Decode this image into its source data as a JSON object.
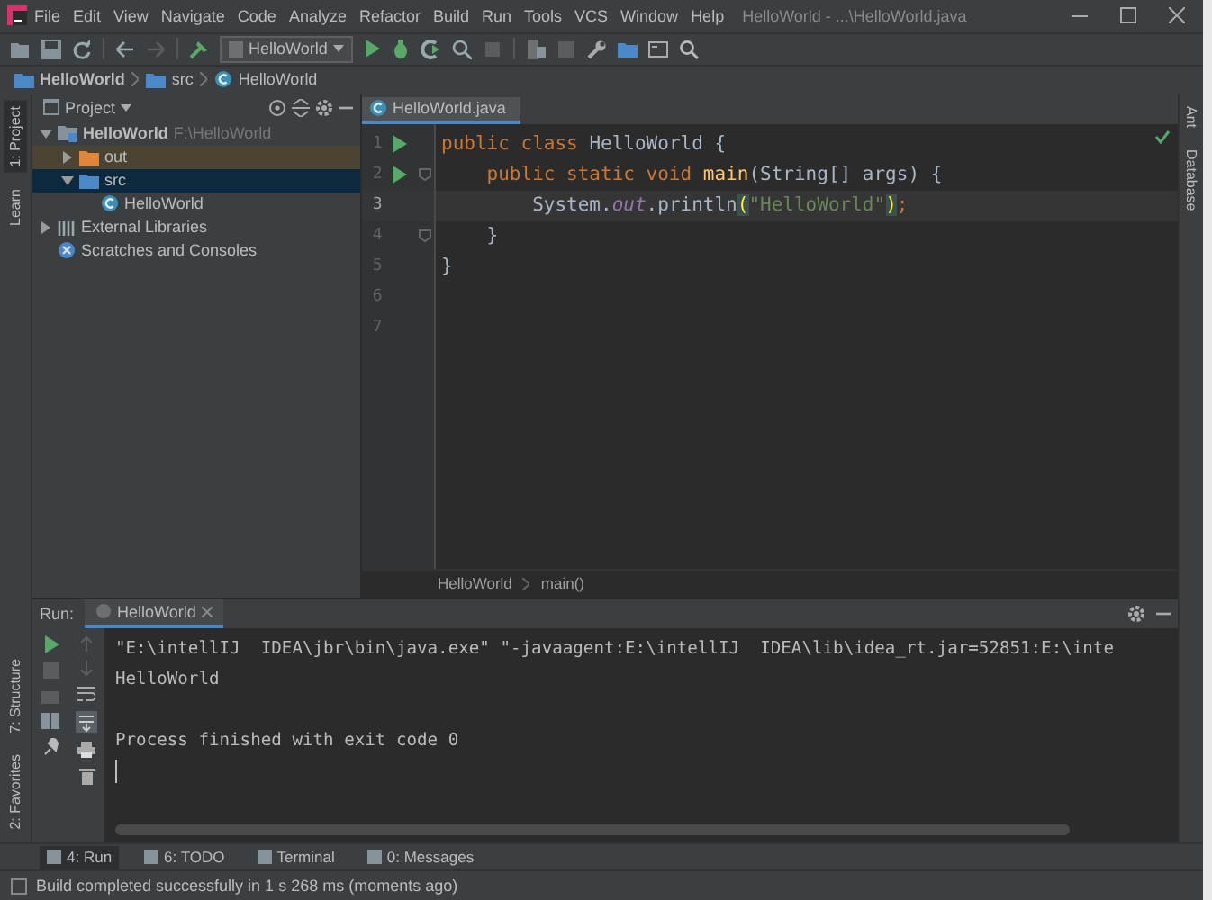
{
  "window": {
    "title": "HelloWorld - ...\\HelloWorld.java"
  },
  "menu": [
    "File",
    "Edit",
    "View",
    "Navigate",
    "Code",
    "Analyze",
    "Refactor",
    "Build",
    "Run",
    "Tools",
    "VCS",
    "Window",
    "Help"
  ],
  "toolbar": {
    "run_config": "HelloWorld"
  },
  "nav_bar": [
    {
      "label": "HelloWorld",
      "kind": "module"
    },
    {
      "label": "src",
      "kind": "folder"
    },
    {
      "label": "HelloWorld",
      "kind": "class"
    }
  ],
  "left_strip_top": [
    {
      "label": "1: Project",
      "selected": true
    },
    {
      "label": "Learn",
      "selected": false
    }
  ],
  "left_strip_bottom": [
    {
      "label": "7: Structure",
      "selected": false
    },
    {
      "label": "2: Favorites",
      "selected": false
    }
  ],
  "project_panel": {
    "title": "Project",
    "tree": [
      {
        "label": "HelloWorld",
        "path": "F:\\HelloWorld",
        "kind": "module",
        "expanded": true,
        "selected": false,
        "children": [
          {
            "label": "out",
            "kind": "excluded-folder",
            "expanded": false,
            "selected": false
          },
          {
            "label": "src",
            "kind": "source-folder",
            "expanded": true,
            "selected": true,
            "children": [
              {
                "label": "HelloWorld",
                "kind": "class",
                "selected": false
              }
            ]
          }
        ]
      },
      {
        "label": "External Libraries",
        "kind": "libraries",
        "expanded": false,
        "selected": false
      },
      {
        "label": "Scratches and Consoles",
        "kind": "scratches",
        "selected": false
      }
    ]
  },
  "editor": {
    "tabs": [
      {
        "label": "HelloWorld.java",
        "selected": true
      }
    ],
    "lines": [
      {
        "number": "1",
        "run_marker": true,
        "fold_marker": false,
        "current": false,
        "tokens": [
          {
            "text": "public class ",
            "kind": "keyword"
          },
          {
            "text": "HelloWorld {",
            "kind": "plain"
          }
        ]
      },
      {
        "number": "2",
        "run_marker": true,
        "fold_marker": true,
        "current": false,
        "tokens": [
          {
            "text": "    public static void ",
            "kind": "keyword"
          },
          {
            "text": "main",
            "kind": "method"
          },
          {
            "text": "(String[] args) {",
            "kind": "plain"
          }
        ]
      },
      {
        "number": "3",
        "run_marker": false,
        "fold_marker": false,
        "current": true,
        "tokens": [
          {
            "text": "        System.",
            "kind": "plain"
          },
          {
            "text": "out",
            "kind": "field"
          },
          {
            "text": ".println",
            "kind": "plain"
          },
          {
            "text": "(",
            "kind": "matched-paren"
          },
          {
            "text": "\"HelloWorld\"",
            "kind": "string"
          },
          {
            "text": ")",
            "kind": "matched-paren"
          },
          {
            "text": ";",
            "kind": "keyword"
          }
        ]
      },
      {
        "number": "4",
        "run_marker": false,
        "fold_marker": true,
        "current": false,
        "tokens": [
          {
            "text": "    }",
            "kind": "plain"
          }
        ]
      },
      {
        "number": "5",
        "run_marker": false,
        "fold_marker": false,
        "current": false,
        "tokens": [
          {
            "text": "}",
            "kind": "plain"
          }
        ]
      },
      {
        "number": "6",
        "run_marker": false,
        "fold_marker": false,
        "current": false
      },
      {
        "number": "7",
        "run_marker": false,
        "fold_marker": false,
        "current": false
      }
    ],
    "breadcrumb": [
      "HelloWorld",
      "main()"
    ]
  },
  "right_strip": [
    "Ant",
    "Database"
  ],
  "run_panel": {
    "label": "Run:",
    "tabs": [
      {
        "label": "HelloWorld",
        "selected": true
      }
    ],
    "console": [
      {
        "text": "\"E:\\intellIJ  IDEA\\jbr\\bin\\java.exe\" \"-javaagent:E:\\intellIJ  IDEA\\lib\\idea_rt.jar=52851:E:\\inte",
        "gap_before": false
      },
      {
        "text": "HelloWorld",
        "gap_before": false
      },
      {
        "text": "Process finished with exit code 0",
        "gap_before": true
      }
    ]
  },
  "bottom_tabs": [
    {
      "label": "4: Run",
      "selected": true
    },
    {
      "label": "6: TODO",
      "selected": false
    },
    {
      "label": "Terminal",
      "selected": false
    },
    {
      "label": "0: Messages",
      "selected": false
    }
  ],
  "status_bar": {
    "text": "Build completed successfully in 1 s 268 ms (moments ago)"
  }
}
